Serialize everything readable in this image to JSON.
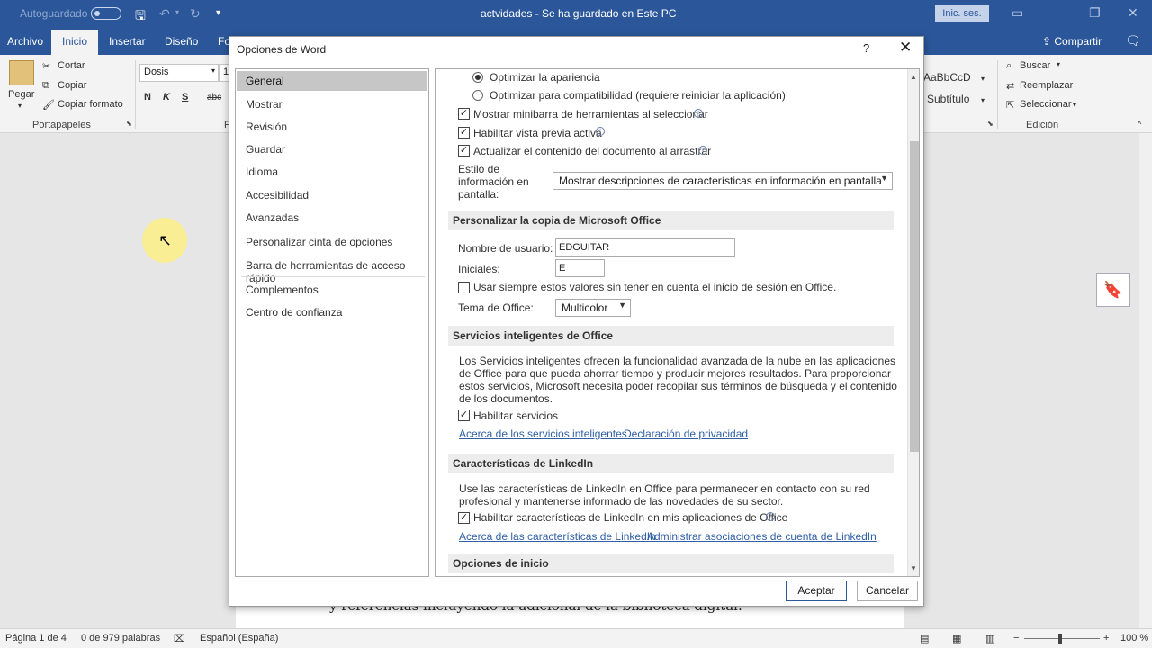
{
  "titlebar": {
    "autosave_label": "Autoguardado",
    "doc_title": "actvidades  -  Se ha guardado en Este PC",
    "signin": "Inic. ses."
  },
  "ribbon_tabs": [
    "Archivo",
    "Inicio",
    "Insertar",
    "Diseño",
    "Fo"
  ],
  "share_label": "Compartir",
  "ribbon": {
    "paste": "Pegar",
    "cut": "Cortar",
    "copy": "Copiar",
    "format_painter": "Copiar formato",
    "clipboard_group": "Portapapeles",
    "font_name": "Dosis",
    "font_size": "1",
    "bold": "N",
    "italic": "K",
    "underline": "S",
    "strike": "abc",
    "style_preview": "AaBbCcD",
    "style_name": "Subtítulo",
    "find": "Buscar",
    "replace": "Reemplazar",
    "select": "Seleccionar",
    "editing_group": "Edición",
    "font_group_initial": "F"
  },
  "document": {
    "visible_text": "y referencias incluyendo la adicional de la biblioteca digital."
  },
  "statusbar": {
    "page": "Página 1 de 4",
    "words": "0 de 979 palabras",
    "language": "Español (España)",
    "zoom": "100 %"
  },
  "dialog": {
    "title": "Opciones de Word",
    "help": "?",
    "nav": {
      "items": [
        {
          "label": "General",
          "selected": true
        },
        {
          "label": "Mostrar"
        },
        {
          "label": "Revisión"
        },
        {
          "label": "Guardar"
        },
        {
          "label": "Idioma"
        },
        {
          "label": "Accesibilidad"
        },
        {
          "label": "Avanzadas"
        },
        {
          "label": "Personalizar cinta de opciones"
        },
        {
          "label": "Barra de herramientas de acceso rápido"
        },
        {
          "label": "Complementos"
        },
        {
          "label": "Centro de confianza"
        }
      ]
    },
    "content": {
      "radio_appearance": "Optimizar la apariencia",
      "radio_compat": "Optimizar para compatibilidad (requiere reiniciar la aplicación)",
      "cb_minibar": "Mostrar minibarra de herramientas al seleccionar",
      "cb_preview": "Habilitar vista previa activa",
      "cb_update": "Actualizar el contenido del documento al arrastrar",
      "tooltip_style_label": "Estilo de información en pantalla:",
      "tooltip_style_value": "Mostrar descripciones de características en información en pantalla",
      "section_personalize": "Personalizar la copia de Microsoft Office",
      "username_label": "Nombre de usuario:",
      "username_value": "EDGUITAR",
      "initials_label": "Iniciales:",
      "initials_value": "E",
      "cb_always": "Usar siempre estos valores sin tener en cuenta el inicio de sesión en Office.",
      "theme_label": "Tema de Office:",
      "theme_value": "Multicolor",
      "section_intelligent": "Servicios inteligentes de Office",
      "intelligent_desc": "Los Servicios inteligentes ofrecen la funcionalidad avanzada de la nube en las aplicaciones de Office para que pueda ahorrar tiempo y producir mejores resultados. Para proporcionar estos servicios, Microsoft necesita poder recopilar sus términos de búsqueda y el contenido de los documentos.",
      "cb_services": "Habilitar servicios",
      "link_about_services": "Acerca de los servicios inteligentes",
      "link_privacy": "Declaración de privacidad",
      "section_linkedin": "Características de LinkedIn",
      "linkedin_desc": "Use las características de LinkedIn en Office para permanecer en contacto con su red profesional y mantenerse informado de las novedades de su sector.",
      "cb_linkedin": "Habilitar características de LinkedIn en mis aplicaciones de Office",
      "link_about_linkedin": "Acerca de las características de LinkedIn",
      "link_manage_linkedin": "Administrar asociaciones de cuenta de LinkedIn",
      "section_startup": "Opciones de inicio"
    },
    "ok": "Aceptar",
    "cancel": "Cancelar"
  }
}
